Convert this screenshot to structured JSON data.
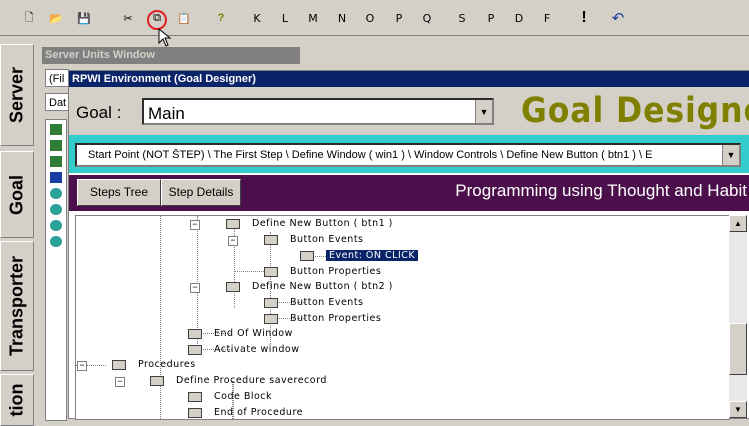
{
  "toolbar": {
    "buttons": [
      {
        "name": "new-file-icon",
        "glyph": "🗋"
      },
      {
        "name": "open-folder-icon",
        "glyph": "📂"
      },
      {
        "name": "save-icon",
        "glyph": "💾"
      },
      {
        "name": "cut-icon",
        "glyph": "✂"
      },
      {
        "name": "copy-icon",
        "glyph": "⧉"
      },
      {
        "name": "paste-icon",
        "glyph": "📋"
      },
      {
        "name": "help-icon",
        "glyph": "?"
      }
    ],
    "letters": [
      "K",
      "L",
      "M",
      "N",
      "O",
      "P",
      "Q",
      "S",
      "P",
      "D",
      "F"
    ],
    "exclaim": "!",
    "undo_glyph": "↶"
  },
  "sidebar": {
    "tabs": [
      "Server",
      "Goal",
      "Transporter",
      "tion"
    ]
  },
  "server_window": {
    "title": "Server Units Window",
    "field1": "(Fil",
    "field2": "Dat"
  },
  "rpwi": {
    "title": "RPWI Environment (Goal Designer)",
    "goal_label": "Goal :",
    "goal_value": "Main",
    "designer_title": "Goal Designer",
    "path": "Start Point (NOT S̄TEP)  \\  The First Step  \\  Define Window  ( win1 )  \\  Window Controls  \\  Define New Button ( btn1 )  \\  E",
    "tabs": [
      "Steps Tree",
      "Step Details"
    ],
    "tagline": "Programming using Thought and Habit"
  },
  "tree": {
    "nodes": [
      {
        "label": "Define New Button ( btn1 )",
        "selected": false
      },
      {
        "label": "Button Events",
        "selected": false
      },
      {
        "label": "Event: ON CLICK",
        "selected": true
      },
      {
        "label": "Button Properties",
        "selected": false
      },
      {
        "label": "Define New Button ( btn2 )",
        "selected": false
      },
      {
        "label": "Button Events",
        "selected": false
      },
      {
        "label": "Button Properties",
        "selected": false
      },
      {
        "label": "End Of Window",
        "selected": false
      },
      {
        "label": "Activate window",
        "selected": false
      },
      {
        "label": "Procedures",
        "selected": false
      },
      {
        "label": "Define Procedure saverecord",
        "selected": false
      },
      {
        "label": "Code Block",
        "selected": false
      },
      {
        "label": "End of Procedure",
        "selected": false
      }
    ]
  },
  "colors": {
    "title_bar": "#0a246a",
    "designer_title": "#808000",
    "path_bar": "#33cccc",
    "tab_bar": "#4b0f4b"
  }
}
